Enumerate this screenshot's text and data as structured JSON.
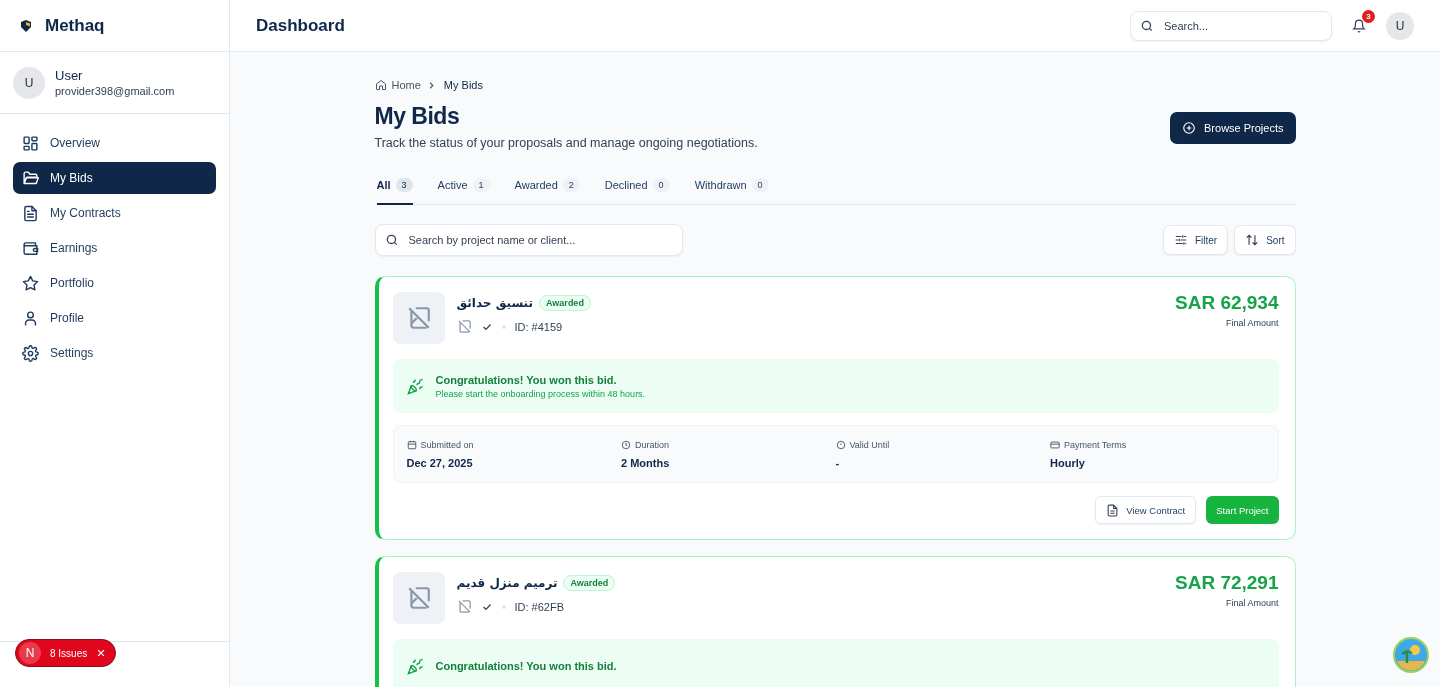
{
  "brand": {
    "name": "Methaq"
  },
  "user": {
    "avatar": "U",
    "name": "User",
    "email": "provider398@gmail.com"
  },
  "nav": [
    {
      "label": "Overview",
      "kind": "grid",
      "selected": false
    },
    {
      "label": "My Bids",
      "kind": "folder",
      "selected": true
    },
    {
      "label": "My Contracts",
      "kind": "doc",
      "selected": false
    },
    {
      "label": "Earnings",
      "kind": "wallet",
      "selected": false
    },
    {
      "label": "Portfolio",
      "kind": "star",
      "selected": false
    },
    {
      "label": "Profile",
      "kind": "person",
      "selected": false
    },
    {
      "label": "Settings",
      "kind": "gear",
      "selected": false
    }
  ],
  "header": {
    "title": "Dashboard",
    "search_placeholder": "Search...",
    "notifications": "3",
    "avatar": "U"
  },
  "breadcrumb": [
    "Home",
    "My Bids"
  ],
  "page": {
    "title": "My Bids",
    "subtitle": "Track the status of your proposals and manage ongoing negotiations.",
    "action": "Browse Projects"
  },
  "tabs": [
    {
      "label": "All",
      "count": "3",
      "selected": true
    },
    {
      "label": "Active",
      "count": "1",
      "selected": false
    },
    {
      "label": "Awarded",
      "count": "2",
      "selected": false
    },
    {
      "label": "Declined",
      "count": "0",
      "selected": false
    },
    {
      "label": "Withdrawn",
      "count": "0",
      "selected": false
    }
  ],
  "toolbar": {
    "search_placeholder": "Search by project name or client...",
    "filter": "Filter",
    "sort": "Sort"
  },
  "bids": [
    {
      "title": "تنسيق حدائق",
      "status": "Awarded",
      "id": "ID: #4159",
      "amount": "SAR 62,934",
      "amount_label": "Final Amount",
      "message": "Congratulations! You won this bid.",
      "message_detail": "Please start the onboarding process within 48 hours.",
      "details": [
        {
          "kind": "calendar",
          "label": "Submitted on",
          "value": "Dec 27, 2025"
        },
        {
          "kind": "clock",
          "label": "Duration",
          "value": "2 Months"
        },
        {
          "kind": "info",
          "label": "Valid Until",
          "value": "-"
        },
        {
          "kind": "card",
          "label": "Payment Terms",
          "value": "Hourly"
        }
      ],
      "actions": [
        {
          "label": "View Contract",
          "kind": "secondary"
        },
        {
          "label": "Start Project",
          "kind": "primary"
        }
      ]
    },
    {
      "title": "ترميم منزل قديم",
      "status": "Awarded",
      "id": "ID: #62FB",
      "amount": "SAR 72,291",
      "amount_label": "Final Amount",
      "message": "Congratulations! You won this bid."
    }
  ],
  "dev_overlay": {
    "logo": "N",
    "label": "8 Issues"
  }
}
